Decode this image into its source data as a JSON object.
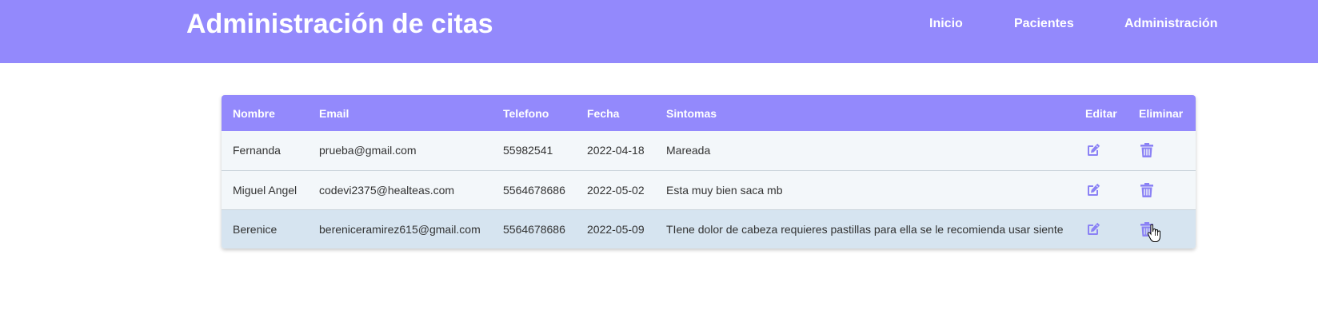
{
  "header": {
    "title": "Administración de citas",
    "nav": {
      "inicio": "Inicio",
      "pacientes": "Pacientes",
      "administracion": "Administración"
    }
  },
  "table": {
    "columns": {
      "nombre": "Nombre",
      "email": "Email",
      "telefono": "Telefono",
      "fecha": "Fecha",
      "sintomas": "Sintomas",
      "editar": "Editar",
      "eliminar": "Eliminar"
    },
    "rows": [
      {
        "nombre": "Fernanda",
        "email": "prueba@gmail.com",
        "telefono": "55982541",
        "fecha": "2022-04-18",
        "sintomas": "Mareada"
      },
      {
        "nombre": "Miguel Angel",
        "email": "codevi2375@healteas.com",
        "telefono": "5564678686",
        "fecha": "2022-05-02",
        "sintomas": "Esta muy bien saca mb"
      },
      {
        "nombre": "Berenice",
        "email": "bereniceramirez615@gmail.com",
        "telefono": "5564678686",
        "fecha": "2022-05-09",
        "sintomas": "TIene dolor de cabeza requieres pastillas para ella se le recomienda usar siente"
      }
    ]
  },
  "icons": {
    "edit": "edit-icon",
    "delete": "trash-icon"
  },
  "colors": {
    "accent": "#9389fc",
    "row": "#f3f7fa",
    "row_hover": "#d6e4f0",
    "icon": "#8b82f5"
  }
}
